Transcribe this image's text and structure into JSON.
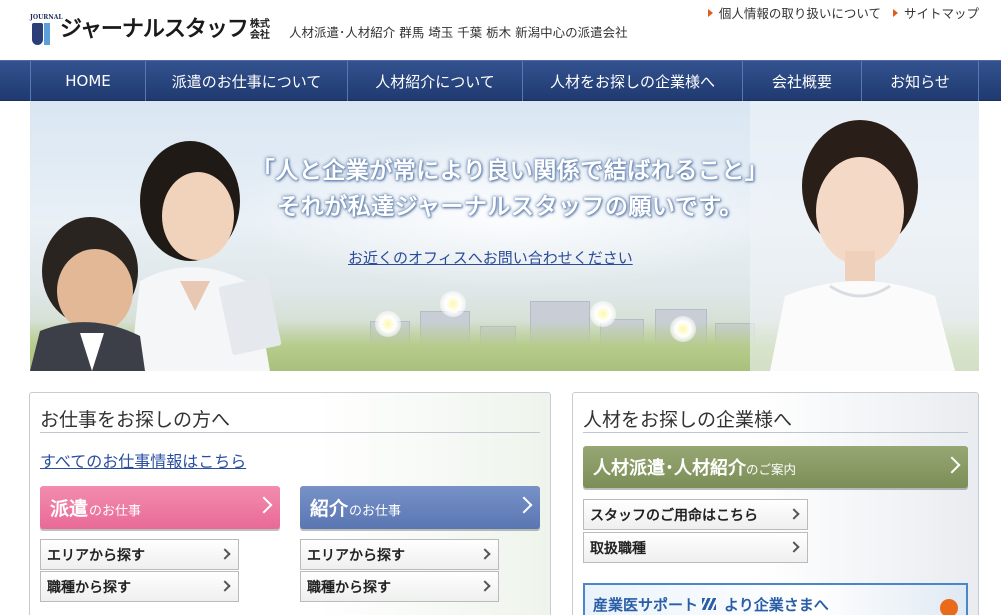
{
  "header": {
    "logo_small": "JOURNAL",
    "logo_name": "ジャーナルスタッフ",
    "logo_suffix_1": "株式",
    "logo_suffix_2": "会社",
    "tagline": "人材派遣･人材紹介 群馬 埼玉 千葉 栃木 新潟中心の派遣会社",
    "links": [
      {
        "label": "個人情報の取り扱いについて"
      },
      {
        "label": "サイトマップ"
      }
    ]
  },
  "nav": {
    "items": [
      {
        "label": "HOME"
      },
      {
        "label": "派遣のお仕事について"
      },
      {
        "label": "人材紹介について"
      },
      {
        "label": "人材をお探しの企業様へ"
      },
      {
        "label": "会社概要"
      },
      {
        "label": "お知らせ"
      }
    ]
  },
  "hero": {
    "line1": "「人と企業が常により良い関係で結ばれること」",
    "line2": "それが私達ジャーナルスタッフの願いです。",
    "link": "お近くのオフィスへお問い合わせください"
  },
  "job_seekers": {
    "title": "お仕事をお探しの方へ",
    "all_jobs_link": "すべてのお仕事情報はこちら",
    "haken": {
      "main": "派遣",
      "sub": "のお仕事"
    },
    "shokai": {
      "main": "紹介",
      "sub": "のお仕事"
    },
    "haken_sub": [
      {
        "label": "エリアから探す"
      },
      {
        "label": "職種から探す"
      }
    ],
    "shokai_sub": [
      {
        "label": "エリアから探す"
      },
      {
        "label": "職種から探す"
      }
    ]
  },
  "companies": {
    "title": "人材をお探しの企業様へ",
    "guide": {
      "main": "人材派遣･人材紹介",
      "sub": "のご案内"
    },
    "sub_buttons": [
      {
        "label": "スタッフのご用命はこちら"
      },
      {
        "label": "取扱職種"
      }
    ],
    "banner": {
      "left": "産業医サポート",
      "right": "より企業さまへ"
    }
  },
  "colors": {
    "nav": "#274479",
    "haken": "#eb77a0",
    "shokai": "#6983bd",
    "green": "#8a9b65",
    "link": "#2a4fa0",
    "accent_orange": "#e45a1a"
  }
}
